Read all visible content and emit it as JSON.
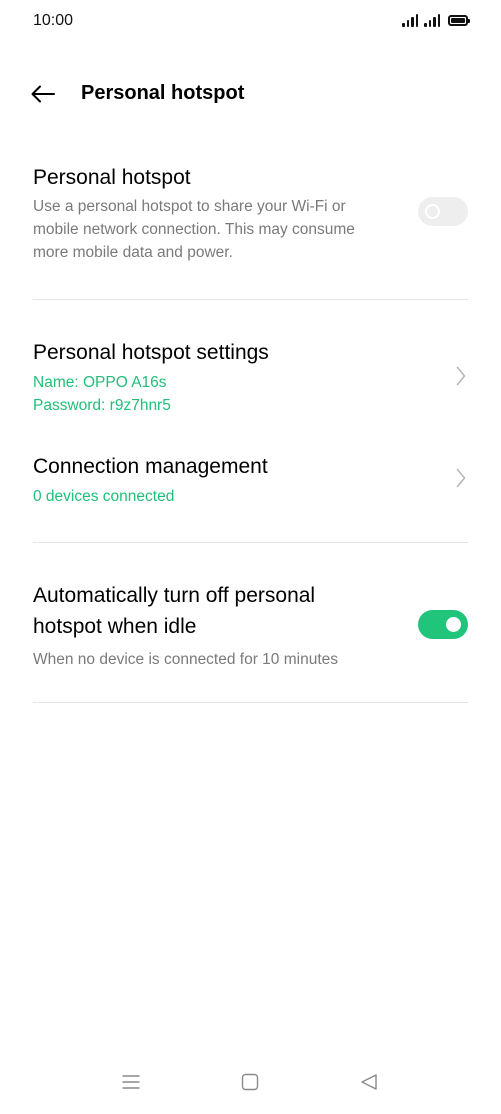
{
  "status_bar": {
    "time": "10:00",
    "icons": [
      "signal-icon",
      "signal-icon",
      "battery-icon"
    ]
  },
  "header": {
    "title": "Personal hotspot",
    "back_icon": "arrow-left-icon"
  },
  "hotspot": {
    "title": "Personal hotspot",
    "description": "Use a personal hotspot to share your Wi-Fi or mobile network connection. This may consume more mobile data and power.",
    "toggle_state": "off"
  },
  "settings": {
    "title": "Personal hotspot settings",
    "name": "Name: OPPO A16s",
    "password": "Password: r9z7hnr5"
  },
  "connection": {
    "title": "Connection management",
    "status": "0 devices connected"
  },
  "auto_off": {
    "title": "Automatically turn off personal hotspot when idle",
    "description": "When no device is connected for 10 minutes",
    "toggle_state": "on"
  },
  "nav": {
    "icons": [
      "menu-icon",
      "home-icon",
      "back-triangle-icon"
    ]
  },
  "colors": {
    "accent": "#20c47a",
    "secondary_text": "#7a7a7a",
    "divider": "#e6e6e6"
  }
}
